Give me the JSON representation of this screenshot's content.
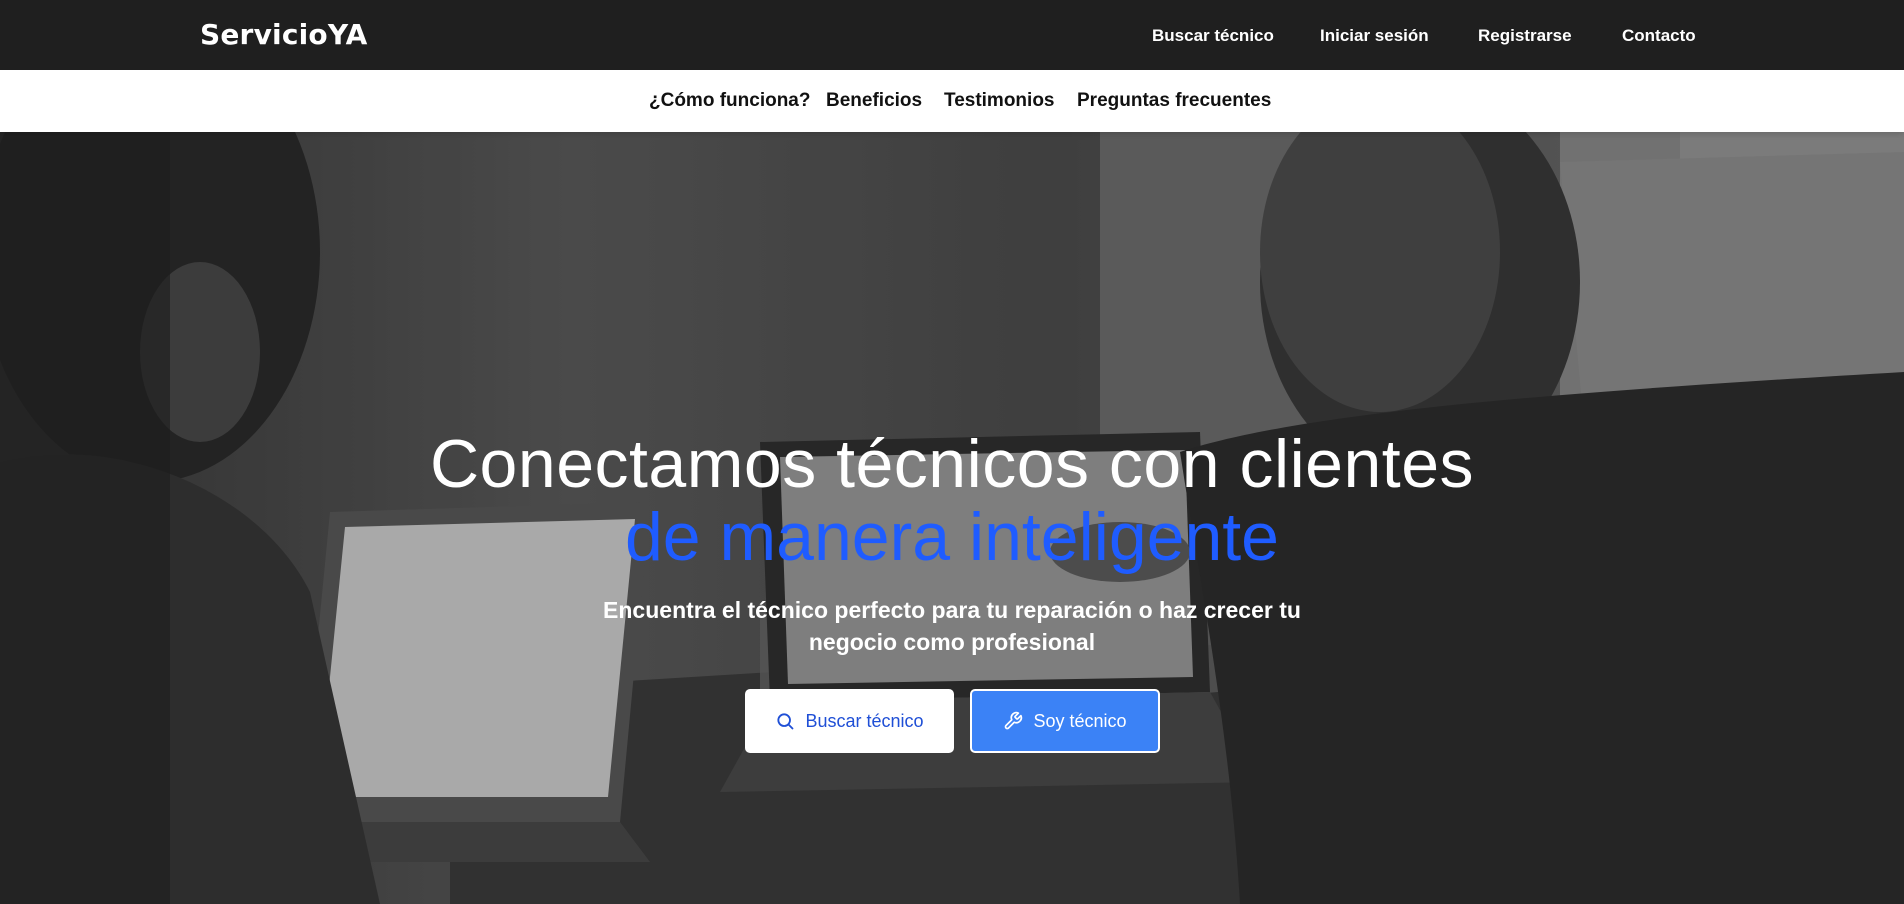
{
  "brand": {
    "name": "ServicioYA"
  },
  "topnav": {
    "items": [
      {
        "label": "Buscar técnico"
      },
      {
        "label": "Iniciar sesión"
      },
      {
        "label": "Registrarse"
      },
      {
        "label": "Contacto"
      }
    ]
  },
  "subnav": {
    "items": [
      {
        "label": "¿Cómo funciona?"
      },
      {
        "label": "Beneficios"
      },
      {
        "label": "Testimonios"
      },
      {
        "label": "Preguntas frecuentes"
      }
    ]
  },
  "hero": {
    "headline_line1": "Conectamos técnicos con clientes",
    "headline_line2": "de manera inteligente",
    "subtitle": "Encuentra el técnico perfecto para tu reparación o haz crecer tu negocio como profesional",
    "primary_button": {
      "label": "Buscar técnico",
      "icon": "search-icon"
    },
    "secondary_button": {
      "label": "Soy técnico",
      "icon": "wrench-icon"
    }
  },
  "colors": {
    "topbar": "#1f1f1f",
    "accent": "#1f5cff",
    "button_blue": "#3b82f6"
  }
}
